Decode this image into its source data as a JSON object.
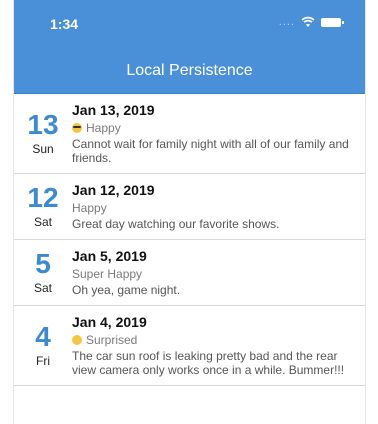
{
  "status": {
    "time": "1:34"
  },
  "nav": {
    "title": "Local Persistence"
  },
  "entries": [
    {
      "day_num": "13",
      "day_name": "Sun",
      "date": "Jan 13, 2019",
      "mood": "Happy",
      "mood_icon": "sunglasses-emoji-icon",
      "note": "Cannot wait for family night with all of our family and friends."
    },
    {
      "day_num": "12",
      "day_name": "Sat",
      "date": "Jan 12, 2019",
      "mood": "Happy",
      "mood_icon": "",
      "note": "Great day watching our favorite shows."
    },
    {
      "day_num": "5",
      "day_name": "Sat",
      "date": "Jan 5, 2019",
      "mood": "Super Happy",
      "mood_icon": "",
      "note": "Oh yea, game night."
    },
    {
      "day_num": "4",
      "day_name": "Fri",
      "date": "Jan 4, 2019",
      "mood": "Surprised",
      "mood_icon": "surprised-emoji-icon",
      "note": "The car sun roof is leaking pretty bad and the rear view camera only works once in a while. Bummer!!!"
    }
  ]
}
